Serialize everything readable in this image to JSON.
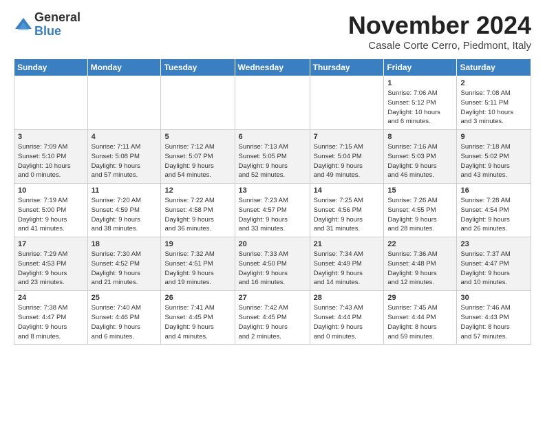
{
  "logo": {
    "general": "General",
    "blue": "Blue"
  },
  "header": {
    "month": "November 2024",
    "location": "Casale Corte Cerro, Piedmont, Italy"
  },
  "weekdays": [
    "Sunday",
    "Monday",
    "Tuesday",
    "Wednesday",
    "Thursday",
    "Friday",
    "Saturday"
  ],
  "weeks": [
    [
      {
        "day": "",
        "info": ""
      },
      {
        "day": "",
        "info": ""
      },
      {
        "day": "",
        "info": ""
      },
      {
        "day": "",
        "info": ""
      },
      {
        "day": "",
        "info": ""
      },
      {
        "day": "1",
        "info": "Sunrise: 7:06 AM\nSunset: 5:12 PM\nDaylight: 10 hours\nand 6 minutes."
      },
      {
        "day": "2",
        "info": "Sunrise: 7:08 AM\nSunset: 5:11 PM\nDaylight: 10 hours\nand 3 minutes."
      }
    ],
    [
      {
        "day": "3",
        "info": "Sunrise: 7:09 AM\nSunset: 5:10 PM\nDaylight: 10 hours\nand 0 minutes."
      },
      {
        "day": "4",
        "info": "Sunrise: 7:11 AM\nSunset: 5:08 PM\nDaylight: 9 hours\nand 57 minutes."
      },
      {
        "day": "5",
        "info": "Sunrise: 7:12 AM\nSunset: 5:07 PM\nDaylight: 9 hours\nand 54 minutes."
      },
      {
        "day": "6",
        "info": "Sunrise: 7:13 AM\nSunset: 5:05 PM\nDaylight: 9 hours\nand 52 minutes."
      },
      {
        "day": "7",
        "info": "Sunrise: 7:15 AM\nSunset: 5:04 PM\nDaylight: 9 hours\nand 49 minutes."
      },
      {
        "day": "8",
        "info": "Sunrise: 7:16 AM\nSunset: 5:03 PM\nDaylight: 9 hours\nand 46 minutes."
      },
      {
        "day": "9",
        "info": "Sunrise: 7:18 AM\nSunset: 5:02 PM\nDaylight: 9 hours\nand 43 minutes."
      }
    ],
    [
      {
        "day": "10",
        "info": "Sunrise: 7:19 AM\nSunset: 5:00 PM\nDaylight: 9 hours\nand 41 minutes."
      },
      {
        "day": "11",
        "info": "Sunrise: 7:20 AM\nSunset: 4:59 PM\nDaylight: 9 hours\nand 38 minutes."
      },
      {
        "day": "12",
        "info": "Sunrise: 7:22 AM\nSunset: 4:58 PM\nDaylight: 9 hours\nand 36 minutes."
      },
      {
        "day": "13",
        "info": "Sunrise: 7:23 AM\nSunset: 4:57 PM\nDaylight: 9 hours\nand 33 minutes."
      },
      {
        "day": "14",
        "info": "Sunrise: 7:25 AM\nSunset: 4:56 PM\nDaylight: 9 hours\nand 31 minutes."
      },
      {
        "day": "15",
        "info": "Sunrise: 7:26 AM\nSunset: 4:55 PM\nDaylight: 9 hours\nand 28 minutes."
      },
      {
        "day": "16",
        "info": "Sunrise: 7:28 AM\nSunset: 4:54 PM\nDaylight: 9 hours\nand 26 minutes."
      }
    ],
    [
      {
        "day": "17",
        "info": "Sunrise: 7:29 AM\nSunset: 4:53 PM\nDaylight: 9 hours\nand 23 minutes."
      },
      {
        "day": "18",
        "info": "Sunrise: 7:30 AM\nSunset: 4:52 PM\nDaylight: 9 hours\nand 21 minutes."
      },
      {
        "day": "19",
        "info": "Sunrise: 7:32 AM\nSunset: 4:51 PM\nDaylight: 9 hours\nand 19 minutes."
      },
      {
        "day": "20",
        "info": "Sunrise: 7:33 AM\nSunset: 4:50 PM\nDaylight: 9 hours\nand 16 minutes."
      },
      {
        "day": "21",
        "info": "Sunrise: 7:34 AM\nSunset: 4:49 PM\nDaylight: 9 hours\nand 14 minutes."
      },
      {
        "day": "22",
        "info": "Sunrise: 7:36 AM\nSunset: 4:48 PM\nDaylight: 9 hours\nand 12 minutes."
      },
      {
        "day": "23",
        "info": "Sunrise: 7:37 AM\nSunset: 4:47 PM\nDaylight: 9 hours\nand 10 minutes."
      }
    ],
    [
      {
        "day": "24",
        "info": "Sunrise: 7:38 AM\nSunset: 4:47 PM\nDaylight: 9 hours\nand 8 minutes."
      },
      {
        "day": "25",
        "info": "Sunrise: 7:40 AM\nSunset: 4:46 PM\nDaylight: 9 hours\nand 6 minutes."
      },
      {
        "day": "26",
        "info": "Sunrise: 7:41 AM\nSunset: 4:45 PM\nDaylight: 9 hours\nand 4 minutes."
      },
      {
        "day": "27",
        "info": "Sunrise: 7:42 AM\nSunset: 4:45 PM\nDaylight: 9 hours\nand 2 minutes."
      },
      {
        "day": "28",
        "info": "Sunrise: 7:43 AM\nSunset: 4:44 PM\nDaylight: 9 hours\nand 0 minutes."
      },
      {
        "day": "29",
        "info": "Sunrise: 7:45 AM\nSunset: 4:44 PM\nDaylight: 8 hours\nand 59 minutes."
      },
      {
        "day": "30",
        "info": "Sunrise: 7:46 AM\nSunset: 4:43 PM\nDaylight: 8 hours\nand 57 minutes."
      }
    ]
  ]
}
